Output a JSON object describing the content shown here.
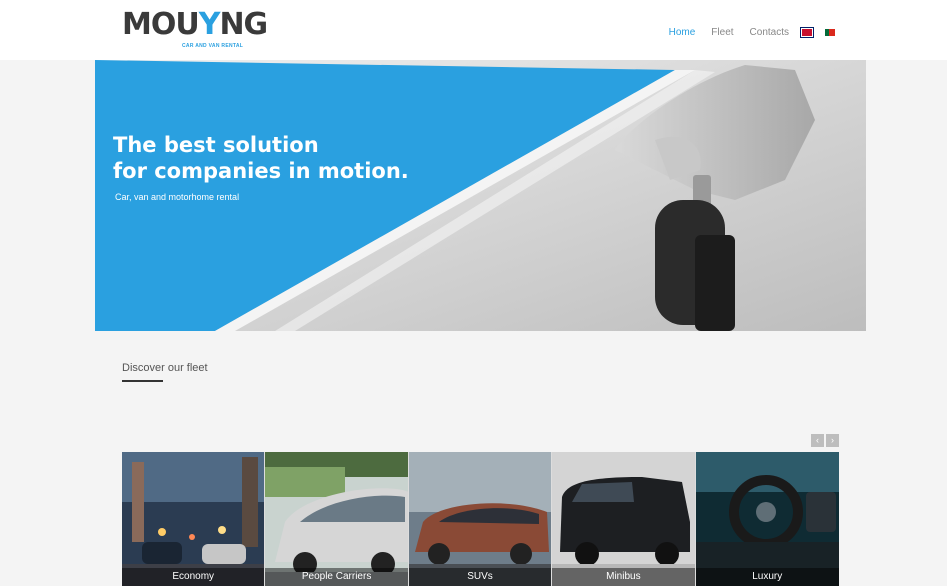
{
  "brand": {
    "logo_main": "MOUYNG",
    "logo_sub": "CAR AND VAN RENTAL",
    "accent": "#2aa0e0"
  },
  "nav": {
    "items": [
      {
        "label": "Home",
        "active": true
      },
      {
        "label": "Fleet",
        "active": false
      },
      {
        "label": "Contacts",
        "active": false
      }
    ],
    "languages": [
      "en",
      "pt"
    ]
  },
  "hero": {
    "title_line1": "The best solution",
    "title_line2": "for companies in motion.",
    "subtitle": "Car, van and motorhome rental"
  },
  "fleet": {
    "section_title": "Discover our fleet",
    "prev_icon": "chevron-left-icon",
    "next_icon": "chevron-right-icon",
    "categories": [
      {
        "label": "Economy"
      },
      {
        "label": "People Carriers"
      },
      {
        "label": "SUVs"
      },
      {
        "label": "Minibus"
      },
      {
        "label": "Luxury"
      }
    ]
  }
}
